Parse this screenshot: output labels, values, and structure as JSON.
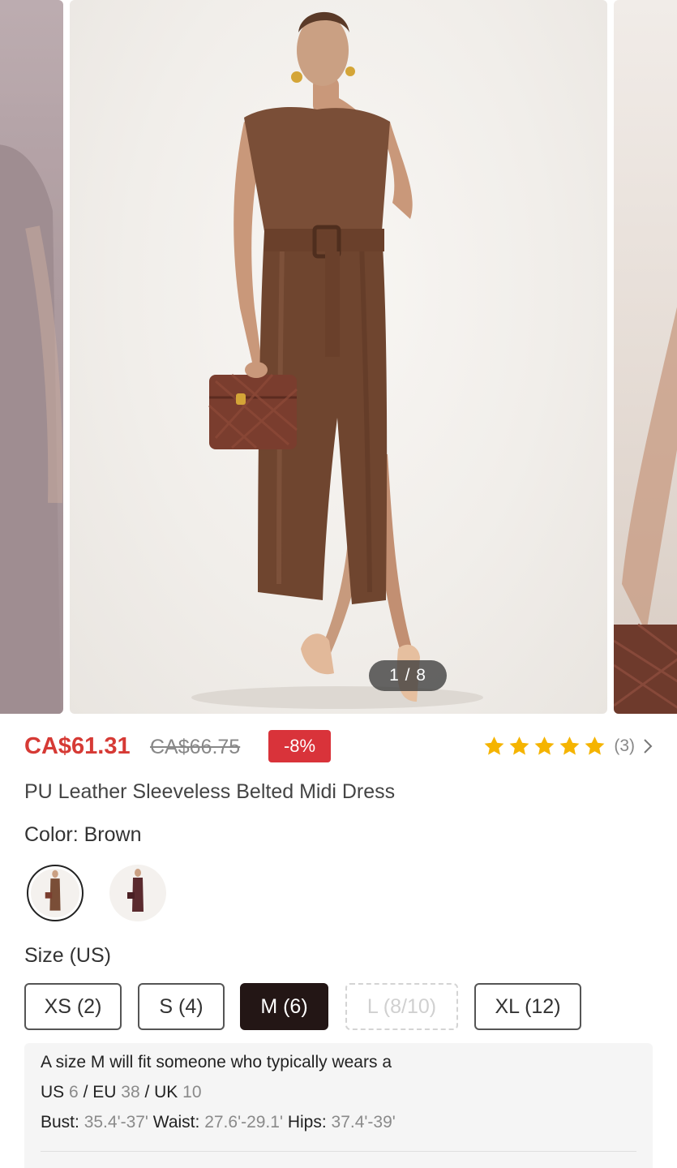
{
  "carousel": {
    "counter": "1 / 8"
  },
  "price": {
    "current": "CA$61.31",
    "original": "CA$66.75",
    "discount": "-8%"
  },
  "rating": {
    "stars": 5,
    "count": "(3)"
  },
  "product": {
    "title": "PU Leather Sleeveless Belted Midi Dress"
  },
  "color": {
    "label": "Color: Brown",
    "options": [
      "Brown",
      "Burgundy"
    ],
    "selected": "Brown"
  },
  "size": {
    "label": "Size (US)",
    "options": [
      {
        "label": "XS (2)",
        "state": "normal"
      },
      {
        "label": "S (4)",
        "state": "normal"
      },
      {
        "label": "M (6)",
        "state": "selected"
      },
      {
        "label": "L (8/10)",
        "state": "disabled"
      },
      {
        "label": "XL (12)",
        "state": "normal"
      }
    ]
  },
  "fit": {
    "intro": "A size M will fit someone who typically wears a",
    "us_label": "US",
    "us_value": "6",
    "eu_label": "EU",
    "eu_value": "38",
    "uk_label": "UK",
    "uk_value": "10",
    "bust_label": "Bust:",
    "bust_value": "35.4'-37'",
    "waist_label": "Waist:",
    "waist_value": "27.6'-29.1'",
    "hips_label": "Hips:",
    "hips_value": "37.4'-39'"
  },
  "colors": {
    "price_red": "#d63a35",
    "discount_bg": "#d9333a",
    "star_gold": "#f5b400",
    "selected_size_bg": "#231615",
    "dress_brown": "#7a4e37"
  }
}
